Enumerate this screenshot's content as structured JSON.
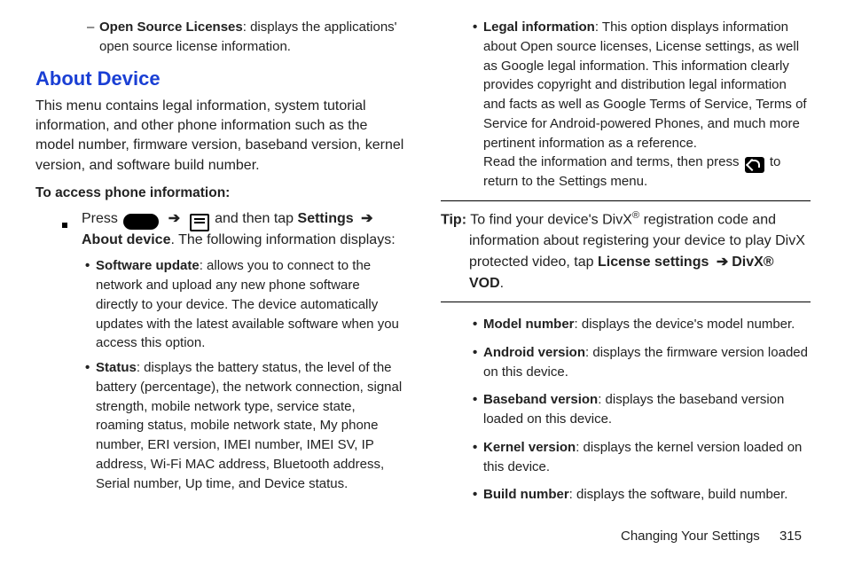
{
  "left": {
    "open_source": {
      "title": "Open Source Licenses",
      "desc": ": displays the applications' open source license information."
    },
    "section_heading": "About Device",
    "intro": "This menu contains legal information, system tutorial information, and other phone information such as the model number, firmware version, baseband version, kernel version, and software build number.",
    "access_heading": "To access phone information:",
    "press_pre": "Press ",
    "press_mid1": " and then tap ",
    "settings_label": "Settings",
    "about_device_label": "About device",
    "press_post": ". The following information displays:",
    "software_update": {
      "title": "Software update",
      "desc": ": allows you to connect to the network and upload any new phone software directly to your device. The device automatically updates with the latest available software when you access this option."
    },
    "status": {
      "title": "Status",
      "desc": ": displays the battery status, the level of the battery (percentage), the network connection, signal strength, mobile network type, service state, roaming status, mobile network state, My phone number, ERI version, IMEI number, IMEI SV, IP address, Wi-Fi MAC address, Bluetooth address, Serial number, Up time, and Device status."
    }
  },
  "right": {
    "legal": {
      "title": "Legal information",
      "desc1": ": This option displays information about Open source licenses, License settings, as well as Google legal information. This information clearly provides copyright and distribution legal information and facts as well as Google Terms of Service, Terms of Service for Android-powered Phones, and much more pertinent information as a reference.",
      "read_pre": "Read the information and terms, then press ",
      "read_post": " to return to the Settings menu."
    },
    "tip": {
      "label": "Tip:",
      "line1": " To find your device's DivX",
      "sup": "®",
      "line2": " registration code and information about registering your device to play DivX protected video, tap ",
      "bold1": "License settings ",
      "arrow": "➔",
      "bold2": "DivX® VOD",
      "end": "."
    },
    "model": {
      "title": "Model number",
      "desc": ": displays the device's model number."
    },
    "android": {
      "title": "Android version",
      "desc": ": displays the firmware version loaded on this device."
    },
    "baseband": {
      "title": "Baseband version",
      "desc": ": displays the baseband version loaded on this device."
    },
    "kernel": {
      "title": "Kernel version",
      "desc": ": displays the kernel version loaded on this device."
    },
    "build": {
      "title": "Build number",
      "desc": ": displays the software, build number."
    }
  },
  "footer": {
    "label": "Changing Your Settings",
    "page": "315"
  }
}
